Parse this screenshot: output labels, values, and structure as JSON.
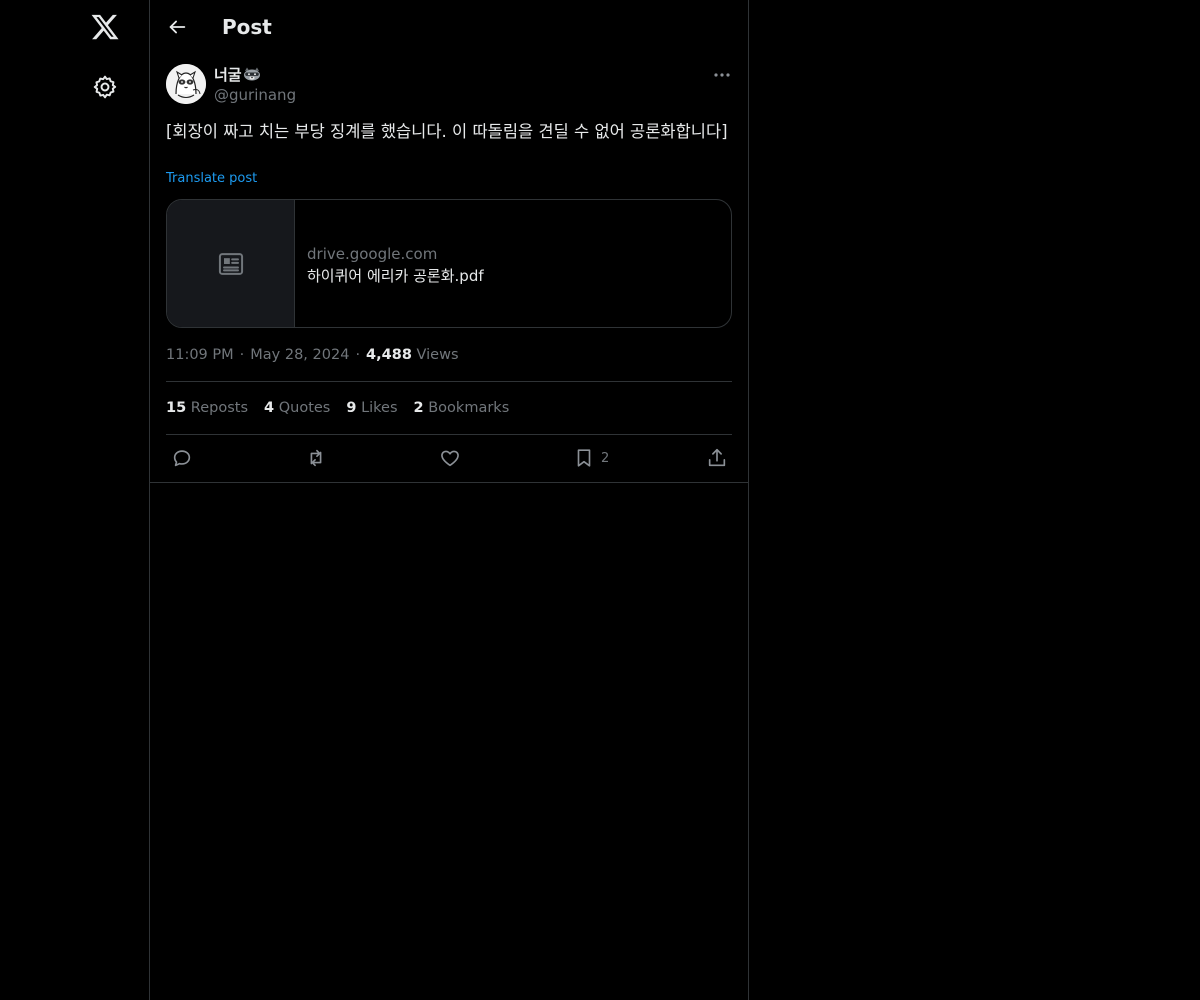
{
  "header": {
    "title": "Post"
  },
  "author": {
    "display_name": "너굴",
    "handle": "@gurinang"
  },
  "post": {
    "text": "[회장이 짜고 치는 부당 징계를 했습니다. 이 따돌림을 견딜 수 없어 공론화합니다]",
    "translate_label": "Translate post"
  },
  "card": {
    "domain": "drive.google.com",
    "title": "하이퀴어 에리카 공론화.pdf"
  },
  "meta": {
    "time": "11:09 PM",
    "date": "May 28, 2024",
    "views_count": "4,488",
    "views_label": "Views"
  },
  "stats": {
    "reposts": {
      "count": "15",
      "label": "Reposts"
    },
    "quotes": {
      "count": "4",
      "label": "Quotes"
    },
    "likes": {
      "count": "9",
      "label": "Likes"
    },
    "bookmarks": {
      "count": "2",
      "label": "Bookmarks"
    }
  },
  "actions": {
    "bookmark_count": "2"
  },
  "colors": {
    "background": "#000000",
    "text": "#e7e9ea",
    "muted": "#71767b",
    "border": "#2f3336",
    "link": "#1d9bf0"
  }
}
